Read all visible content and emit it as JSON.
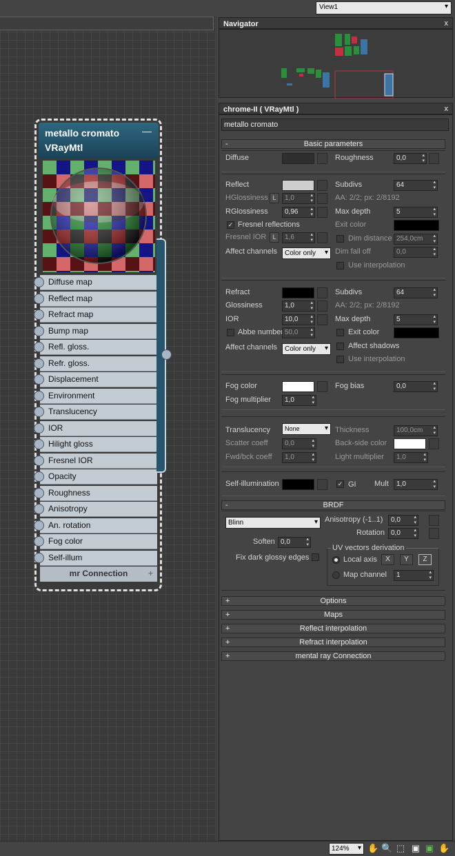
{
  "view_select": {
    "value": "View1"
  },
  "navigator": {
    "title": "Navigator",
    "close": "x"
  },
  "material_panel": {
    "title": "chrome-II  ( VRayMtl )",
    "close": "x",
    "name": "metallo cromato"
  },
  "node": {
    "title1": "metallo cromato",
    "title2": "VRayMtl",
    "minimize": "—",
    "slots": [
      "Diffuse map",
      "Reflect map",
      "Refract map",
      "Bump map",
      "Refl. gloss.",
      "Refr. gloss.",
      "Displacement",
      "Environment",
      "Translucency",
      "IOR",
      "Hilight gloss",
      "Fresnel IOR",
      "Opacity",
      "Roughness",
      "Anisotropy",
      "An. rotation",
      "Fog color",
      "Self-illum"
    ],
    "mr_connection": "mr Connection",
    "mr_plus": "+"
  },
  "basic": {
    "header": "Basic parameters",
    "sign": "-",
    "diffuse": "Diffuse",
    "roughness": "Roughness",
    "roughness_val": "0,0",
    "reflect": "Reflect",
    "hglossiness": "HGlossiness",
    "hglossiness_val": "1,0",
    "l": "L",
    "rglossiness": "RGlossiness",
    "rglossiness_val": "0,96",
    "fresnel_reflections": "Fresnel reflections",
    "fresnel_ior": "Fresnel IOR",
    "fresnel_ior_val": "1,6",
    "affect_channels": "Affect channels",
    "affect_val": "Color only",
    "subdivs": "Subdivs",
    "subdivs_val": "64",
    "aa": "AA: 2/2; px: 2/8192",
    "max_depth": "Max depth",
    "max_depth_val": "5",
    "exit_color": "Exit color",
    "dim_distance": "Dim distance",
    "dim_distance_val": "254,0cm",
    "dim_falloff": "Dim fall off",
    "dim_falloff_val": "0,0",
    "use_interpolation": "Use interpolation",
    "refract": "Refract",
    "glossiness": "Glossiness",
    "glossiness_val": "1,0",
    "ior": "IOR",
    "ior_val": "10,0",
    "abbe": "Abbe number",
    "abbe_val": "50,0",
    "r_subdivs_val": "64",
    "r_max_depth_val": "5",
    "affect_shadows": "Affect shadows",
    "fog_color": "Fog color",
    "fog_bias": "Fog bias",
    "fog_bias_val": "0,0",
    "fog_multiplier": "Fog multiplier",
    "fog_multiplier_val": "1,0",
    "translucency": "Translucency",
    "translucency_val": "None",
    "thickness": "Thickness",
    "thickness_val": "100,0cm",
    "scatter_coeff": "Scatter coeff",
    "scatter_val": "0,0",
    "back_side_color": "Back-side color",
    "fwd_bck_coeff": "Fwd/bck coeff",
    "fwd_val": "1,0",
    "light_multiplier": "Light multiplier",
    "light_mult_val": "1,0",
    "self_illumination": "Self-illumination",
    "gi": "GI",
    "mult": "Mult",
    "mult_val": "1,0"
  },
  "brdf": {
    "header": "BRDF",
    "sign": "-",
    "type": "Blinn",
    "anisotropy": "Anisotropy (-1..1)",
    "anisotropy_val": "0,0",
    "rotation": "Rotation",
    "rotation_val": "0,0",
    "soften": "Soften",
    "soften_val": "0,0",
    "fix_dark": "Fix dark glossy edges",
    "uv_derivation": "UV vectors derivation",
    "local_axis": "Local axis",
    "x": "X",
    "y": "Y",
    "z": "Z",
    "map_channel": "Map channel",
    "map_channel_val": "1"
  },
  "rollouts": [
    {
      "sign": "+",
      "label": "Options"
    },
    {
      "sign": "+",
      "label": "Maps"
    },
    {
      "sign": "+",
      "label": "Reflect interpolation"
    },
    {
      "sign": "+",
      "label": "Refract interpolation"
    },
    {
      "sign": "+",
      "label": "mental ray Connection"
    }
  ],
  "status": {
    "zoom": "124%"
  },
  "colors": {
    "node_header": "#2e6780",
    "reflect_swatch": "#cfcfcf",
    "refract_swatch": "#000000",
    "fog_swatch": "#ffffff"
  }
}
